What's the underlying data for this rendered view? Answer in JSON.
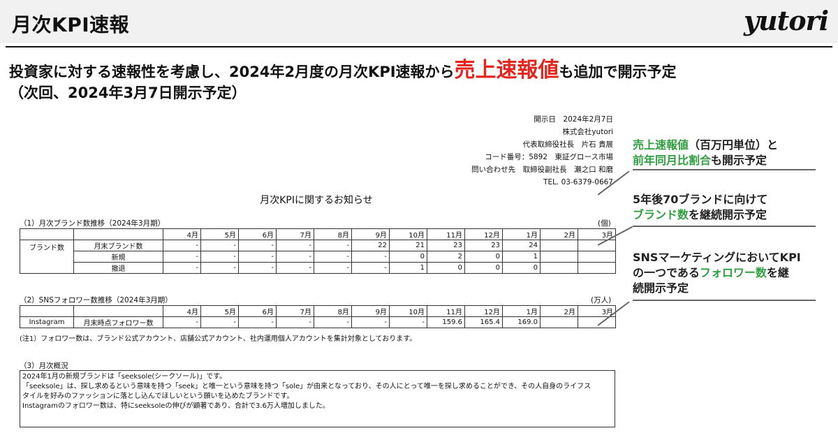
{
  "header": {
    "title": "月次KPI速報",
    "logo_text": "yutori"
  },
  "headline": {
    "part1": "投資家に対する速報性を考慮し、2024年2月度の月次KPI速報から",
    "highlight": "売上速報値",
    "part2": "も追加で開示予定",
    "line2": "（次回、2024年3月7日開示予定）",
    "highlight_color": "#e4261f"
  },
  "document": {
    "info_lines": [
      "開示日　2024年2月7日",
      "株式会社yutori",
      "代表取締役社長　片石 貴展",
      "コード番号：5892　東証グロース市場",
      "問い合わせ先　取締役副社長　瀬之口 和磨",
      "TEL. 03-6379-0667"
    ],
    "title": "月次KPIに関するお知らせ",
    "months": [
      "4月",
      "5月",
      "6月",
      "7月",
      "8月",
      "9月",
      "10月",
      "11月",
      "12月",
      "1月",
      "2月",
      "3月"
    ],
    "brand_section": {
      "label": "（1）月次ブランド数推移（2024年3月期）",
      "unit": "(個)",
      "group_label": "ブランド数",
      "rows": [
        {
          "label": "月末ブランド数",
          "values": [
            "-",
            "-",
            "-",
            "-",
            "-",
            "22",
            "21",
            "23",
            "23",
            "24",
            "",
            ""
          ]
        },
        {
          "label": "新規",
          "values": [
            "-",
            "-",
            "-",
            "-",
            "-",
            "-",
            "0",
            "2",
            "0",
            "1",
            "",
            ""
          ]
        },
        {
          "label": "撤退",
          "values": [
            "-",
            "-",
            "-",
            "-",
            "-",
            "-",
            "1",
            "0",
            "0",
            "0",
            "",
            ""
          ]
        }
      ]
    },
    "sns_section": {
      "label": "（2）SNSフォロワー数推移（2024年3月期）",
      "unit": "(万人)",
      "rows": [
        {
          "group": "Instagram",
          "label": "月末時点フォロワー数",
          "values": [
            "-",
            "-",
            "-",
            "-",
            "-",
            "-",
            "-",
            "159.6",
            "165.4",
            "169.0",
            "",
            ""
          ]
        }
      ],
      "note": "(注1）フォロワー数は、ブランド公式アカウント、店舗公式アカウント、社内運用個人アカウントを集計対象としております。"
    },
    "overview": {
      "label": "（3）月次概況",
      "lines": [
        "2024年1月の新規ブランドは「seeksole(シークソール)」です。",
        "「seeksole」は、探し求めるという意味を持つ「seek」と唯一という意味を持つ「sole」が由来となっており、その人にとって唯一を探し求めることができ、その人自身のライフス",
        "タイルを好みのファッションに落とし込んでほしいという願いを込めたブランドです。",
        "Instagramのフォロワー数は、特にseeksoleの伸びが顕著であり、合計で3.6万人増加しました。"
      ]
    }
  },
  "callouts": {
    "accent_color": "#2e9e3e",
    "c1": {
      "g1": "売上速報値",
      "t1": "（百万円単位）と",
      "g2": "前年同月比割合",
      "t2": "も開示予定"
    },
    "c2": {
      "t1": "5年後70ブランドに向けて",
      "g1": "ブランド数",
      "t2": "を継続開示予定"
    },
    "c3": {
      "t1": "SNSマーケティングにおいてKPI",
      "t2": "の一つである",
      "g1": "フォロワー数",
      "t3": "を継",
      "t4": "続開示予定"
    }
  }
}
